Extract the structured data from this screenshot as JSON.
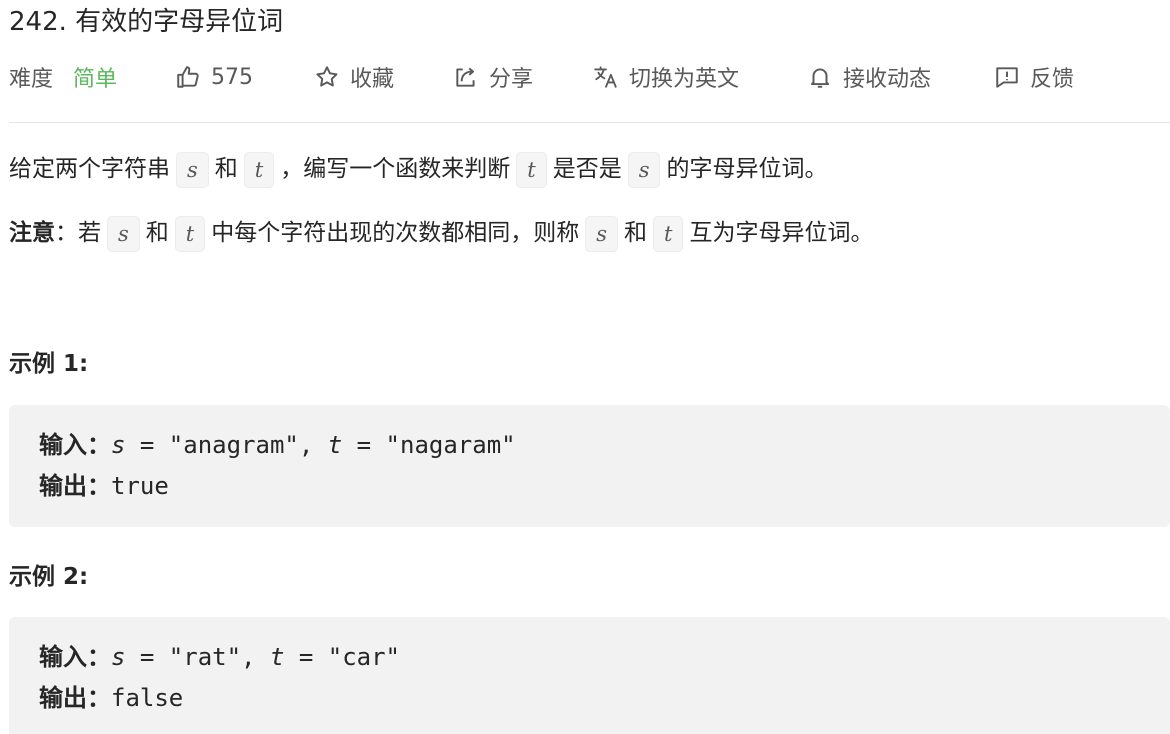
{
  "problem": {
    "title": "242. 有效的字母异位词"
  },
  "meta": {
    "difficulty_label": "难度",
    "difficulty_value": "简单",
    "likes": "575",
    "favorite_label": "收藏",
    "share_label": "分享",
    "translate_label": "切换为英文",
    "subscribe_label": "接收动态",
    "feedback_label": "反馈",
    "colors": {
      "easy": "#5cb85c",
      "text": "#262626",
      "muted": "#595959"
    },
    "icons": [
      "thumbs-up-icon",
      "star-icon",
      "share-icon",
      "translate-icon",
      "bell-icon",
      "feedback-icon"
    ]
  },
  "description": {
    "p1_a": "给定两个字符串",
    "p1_s": "s",
    "p1_b": "和",
    "p1_t": "t",
    "p1_c": "，编写一个函数来判断",
    "p1_t2": "t",
    "p1_d": "是否是",
    "p1_s2": "s",
    "p1_e": "的字母异位词。",
    "p2_strong": "注意",
    "p2_a": "：若",
    "p2_s": "s",
    "p2_b": "和",
    "p2_t": "t",
    "p2_c": "中每个字符出现的次数都相同，则称",
    "p2_s2": "s",
    "p2_d": "和",
    "p2_t2": "t",
    "p2_e": "互为字母异位词。"
  },
  "examples": [
    {
      "heading": "示例 1:",
      "input_label": "输入：",
      "input_s_var": "s",
      "input_s_val": " = \"anagram\", ",
      "input_t_var": "t",
      "input_t_val": " = \"nagaram\"",
      "output_label": "输出：",
      "output_value": "true"
    },
    {
      "heading": "示例 2:",
      "input_label": "输入：",
      "input_s_var": "s",
      "input_s_val": " = \"rat\", ",
      "input_t_var": "t",
      "input_t_val": " = \"car\"",
      "output_label": "输出：",
      "output_value": "false"
    }
  ]
}
